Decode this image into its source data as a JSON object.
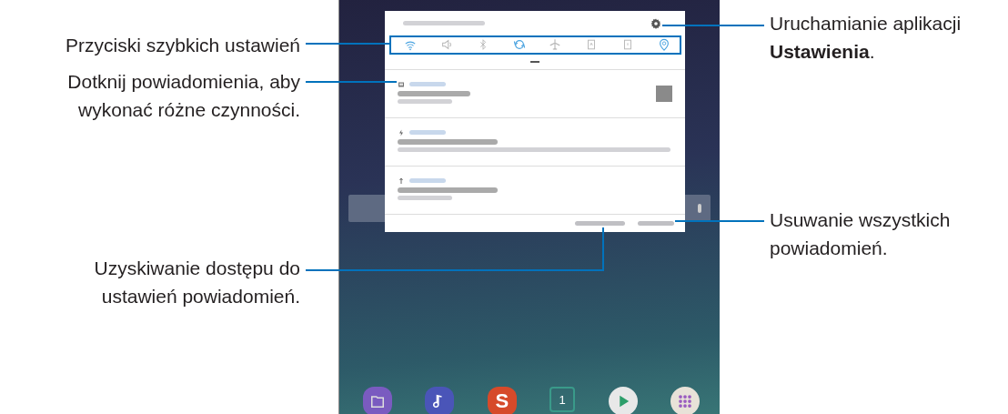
{
  "callouts": [
    {
      "kind": "quick-settings",
      "lines": [
        "Przyciski szybkich ustawień"
      ]
    },
    {
      "kind": "notification",
      "lines": [
        "Dotknij powiadomienia, aby",
        "wykonać różne czynności."
      ]
    },
    {
      "kind": "noti-settings",
      "lines": [
        "Uzyskiwanie dostępu do",
        "ustawień powiadomień."
      ]
    },
    {
      "kind": "gear",
      "lines": [
        "Uruchamianie aplikacji",
        "**Ustawienia**."
      ]
    },
    {
      "kind": "clear-all",
      "lines": [
        "Usuwanie wszystkich",
        "powiadomień."
      ]
    }
  ],
  "quick_settings": [
    {
      "kind": "wifi",
      "on": true
    },
    {
      "kind": "sound",
      "on": false
    },
    {
      "kind": "bluetooth",
      "on": false
    },
    {
      "kind": "sync",
      "on": true
    },
    {
      "kind": "airplane",
      "on": false
    },
    {
      "kind": "rotation",
      "on": false
    },
    {
      "kind": "flashlight",
      "on": false
    },
    {
      "kind": "location",
      "on": true
    }
  ],
  "notifications": [
    {
      "kind": "image",
      "thumbnail": true
    },
    {
      "kind": "charging",
      "thumbnail": false
    },
    {
      "kind": "usb",
      "thumbnail": false
    }
  ],
  "dock": [
    {
      "kind": "folder"
    },
    {
      "kind": "music"
    },
    {
      "kind": "letter",
      "label": "S"
    },
    {
      "kind": "calendar",
      "label": "1"
    },
    {
      "kind": "play"
    },
    {
      "kind": "apps"
    }
  ]
}
